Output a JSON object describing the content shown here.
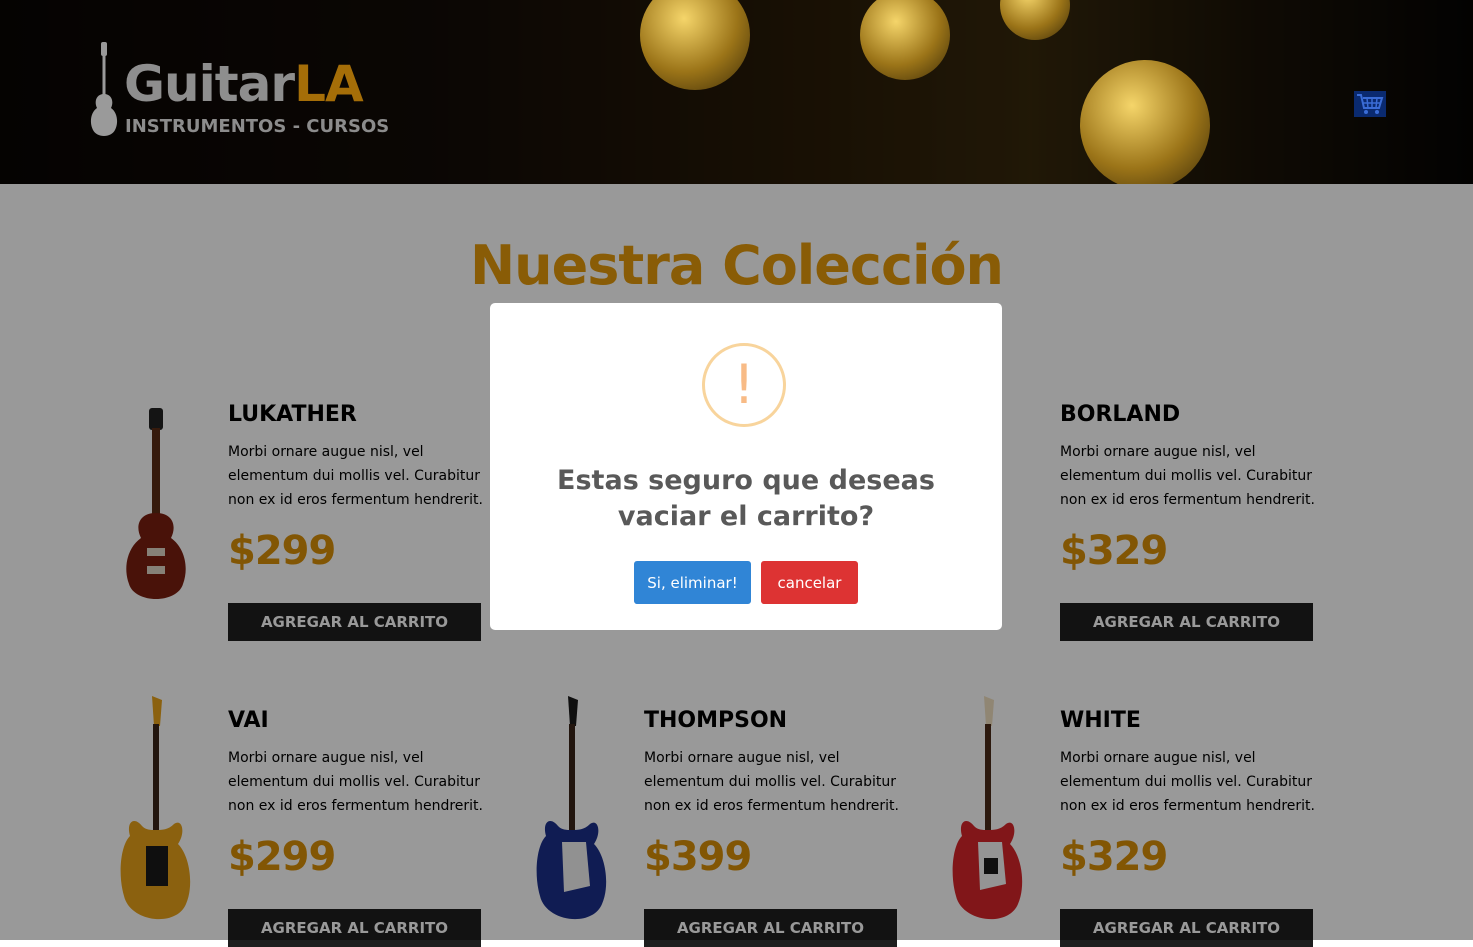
{
  "header": {
    "brand_main": "Guitar",
    "brand_accent": "LA",
    "tagline": "INSTRUMENTOS - CURSOS",
    "cart_icon": "cart-icon"
  },
  "main": {
    "title": "Nuestra Colección",
    "add_label": "AGREGAR AL CARRITO",
    "guitars": [
      {
        "name": "LUKATHER",
        "description": "Morbi ornare augue nisl, vel elementum dui mollis vel. Curabitur non ex id eros fermentum hendrerit.",
        "price": "$299",
        "color": "#7a1f10"
      },
      {
        "name": "",
        "description": "",
        "price": "",
        "color": "#000000"
      },
      {
        "name": "BORLAND",
        "description": "Morbi ornare augue nisl, vel elementum dui mollis vel. Curabitur non ex id eros fermentum hendrerit.",
        "price": "$329",
        "color": "#111111"
      },
      {
        "name": "VAI",
        "description": "Morbi ornare augue nisl, vel elementum dui mollis vel. Curabitur non ex id eros fermentum hendrerit.",
        "price": "$299",
        "color": "#e8a21a"
      },
      {
        "name": "THOMPSON",
        "description": "Morbi ornare augue nisl, vel elementum dui mollis vel. Curabitur non ex id eros fermentum hendrerit.",
        "price": "$399",
        "color": "#1c2f8a"
      },
      {
        "name": "WHITE",
        "description": "Morbi ornare augue nisl, vel elementum dui mollis vel. Curabitur non ex id eros fermentum hendrerit.",
        "price": "$329",
        "color": "#d8262a"
      }
    ]
  },
  "modal": {
    "icon": "warning-icon",
    "icon_glyph": "!",
    "message": "Estas seguro que deseas vaciar el carrito?",
    "confirm_label": "Si, eliminar!",
    "cancel_label": "cancelar"
  },
  "colors": {
    "accent": "#e59a0b",
    "confirm": "#3085d6",
    "cancel": "#dd3333",
    "button_dark": "#1e1e1e"
  }
}
